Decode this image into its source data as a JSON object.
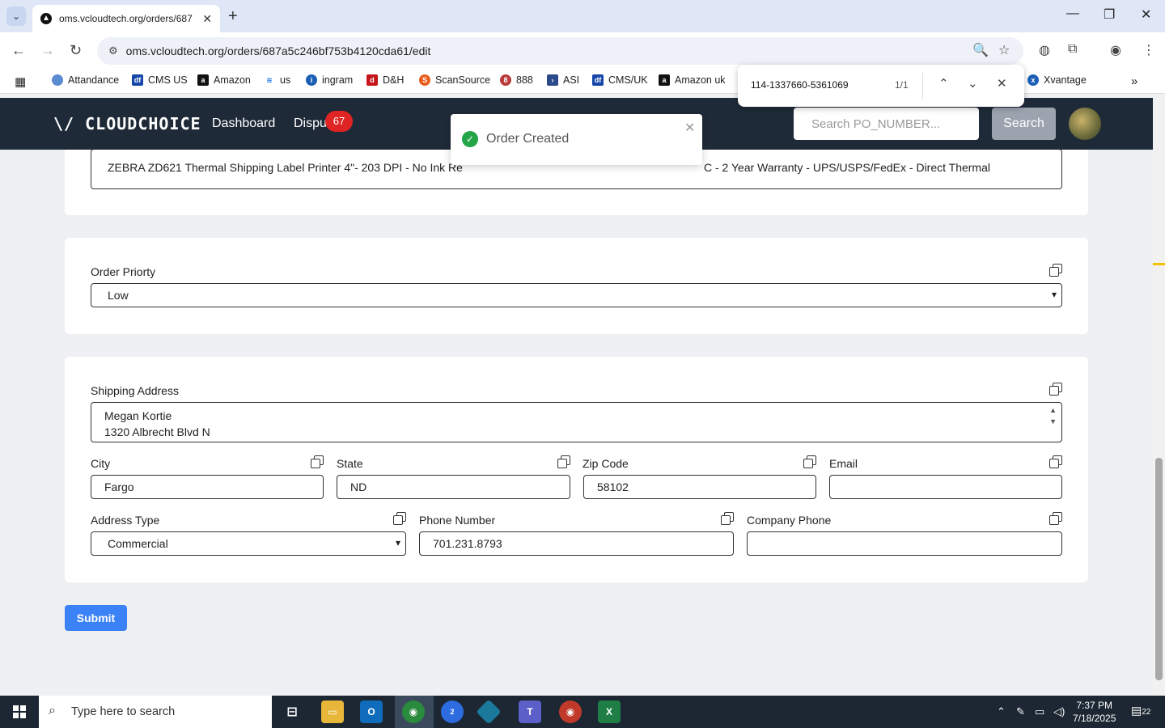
{
  "browser": {
    "tab_title": "oms.vcloudtech.org/orders/687",
    "url": "oms.vcloudtech.org/orders/687a5c246bf753b4120cda61/edit",
    "bookmarks": [
      "Attandance",
      "CMS US",
      "Amazon",
      "us",
      "ingram",
      "D&H",
      "ScanSource",
      "888",
      "ASI",
      "CMS/UK",
      "Amazon uk",
      "Xvantage"
    ],
    "find_query": "114-1337660-5361069",
    "find_count": "1/1"
  },
  "app": {
    "logo": "\\/ CLOUDCHOICE",
    "nav": [
      "Dashboard",
      "Dispu"
    ],
    "badge": "67",
    "search_placeholder": "Search PO_NUMBER...",
    "search_label": "Search"
  },
  "toast": {
    "message": "Order Created"
  },
  "form": {
    "product_description": "ZEBRA ZD621 Thermal Shipping Label Printer 4\"- 203 DPI - No Ink Re",
    "product_description_tail": "C - 2 Year Warranty - UPS/USPS/FedEx - Direct Thermal",
    "order_priority_label": "Order Priorty",
    "order_priority_value": "Low",
    "shipping_address_label": "Shipping Address",
    "shipping_address_line1": "Megan Kortie",
    "shipping_address_line2": "1320 Albrecht Blvd N",
    "city_label": "City",
    "city_value": "Fargo",
    "state_label": "State",
    "state_value": "ND",
    "zip_label": "Zip Code",
    "zip_value": "58102",
    "email_label": "Email",
    "email_value": "",
    "address_type_label": "Address Type",
    "address_type_value": "Commercial",
    "phone_label": "Phone Number",
    "phone_value": "701.231.8793",
    "company_phone_label": "Company Phone",
    "company_phone_value": "",
    "submit_label": "Submit"
  },
  "taskbar": {
    "search_placeholder": "Type here to search",
    "time": "7:37 PM",
    "date": "7/18/2025",
    "notifications": "22",
    "zoom_badge": "2"
  }
}
